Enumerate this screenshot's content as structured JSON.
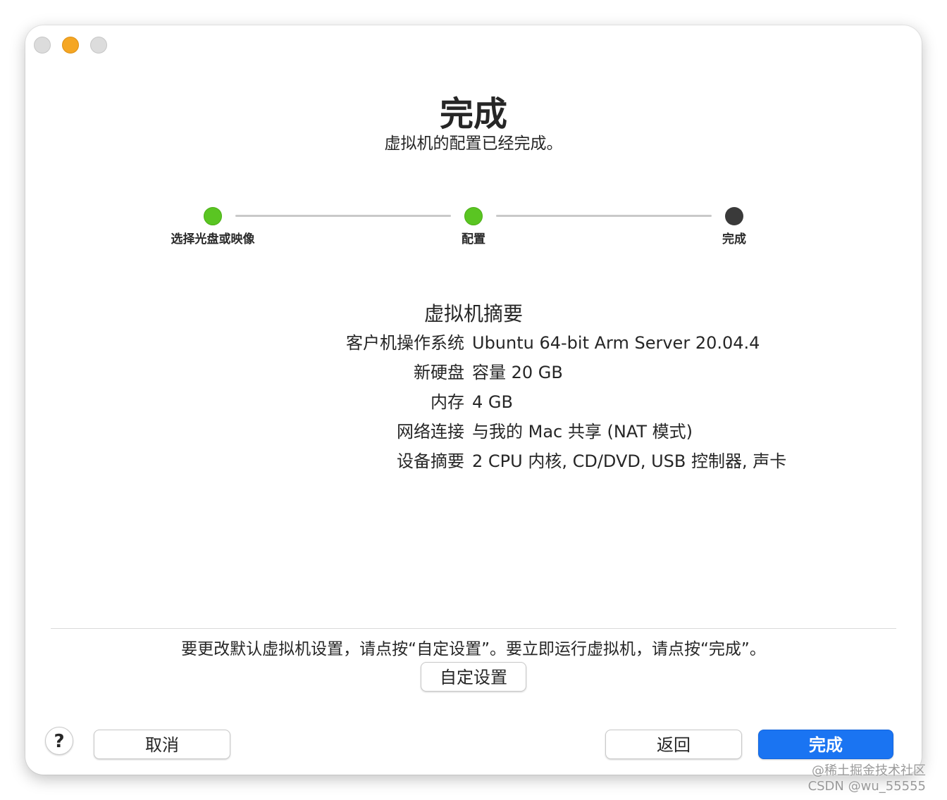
{
  "window": {
    "title": "完成",
    "subtitle": "虚拟机的配置已经完成。"
  },
  "stepper": {
    "steps": [
      {
        "label": "选择光盘或映像",
        "status": "done"
      },
      {
        "label": "配置",
        "status": "done"
      },
      {
        "label": "完成",
        "status": "current"
      }
    ]
  },
  "summary": {
    "title": "虚拟机摘要",
    "rows": [
      {
        "key": "客户机操作系统",
        "value": "Ubuntu 64-bit Arm Server 20.04.4"
      },
      {
        "key": "新硬盘",
        "value": "容量 20 GB"
      },
      {
        "key": "内存",
        "value": "4 GB"
      },
      {
        "key": "网络连接",
        "value": "与我的 Mac 共享 (NAT 模式)"
      },
      {
        "key": "设备摘要",
        "value": "2 CPU 内核, CD/DVD, USB 控制器, 声卡"
      }
    ]
  },
  "footer": {
    "hint": "要更改默认虚拟机设置，请点按“自定设置”。要立即运行虚拟机，请点按“完成”。",
    "customize_label": "自定设置",
    "help_label": "?",
    "cancel_label": "取消",
    "back_label": "返回",
    "finish_label": "完成"
  },
  "watermark": {
    "line1": "@稀土掘金技术社区",
    "line2": "CSDN @wu_55555"
  },
  "colors": {
    "accent": "#1a74f2",
    "step_done": "#5ac522",
    "step_current": "#3a3a3a",
    "minimize": "#f5a623"
  }
}
